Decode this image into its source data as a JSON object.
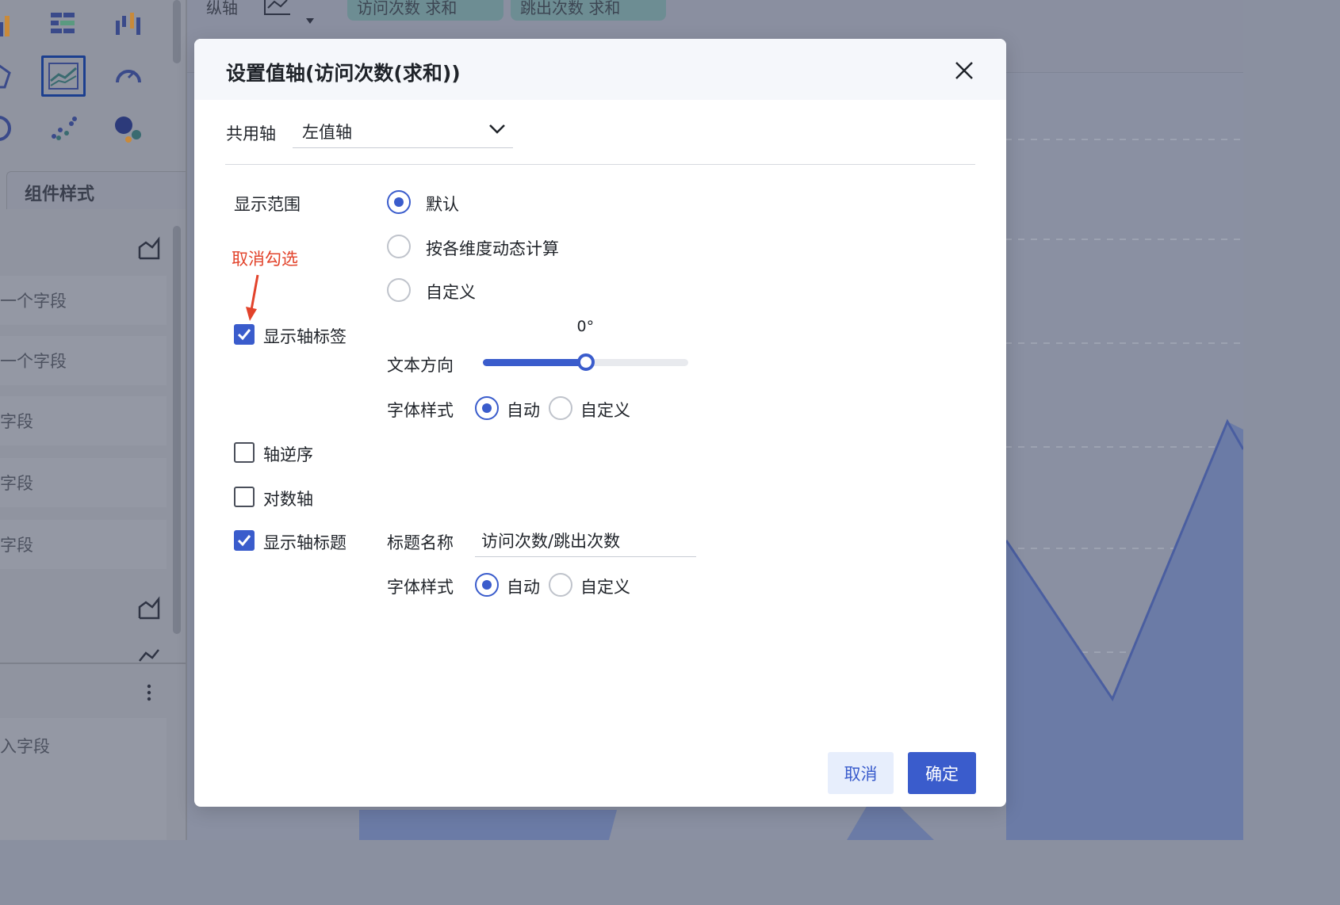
{
  "background": {
    "sidebar": {
      "style_tab_label": "组件样式",
      "field_slots": [
        "一个字段",
        "一个字段",
        "字段",
        "字段",
        "字段"
      ],
      "bottom_field_slot": "入字段"
    },
    "topbar": {
      "axis_label": "纵轴",
      "pills": [
        "访问次数 求和",
        "跳出次数 求和"
      ]
    }
  },
  "dialog": {
    "title": "设置值轴(访问次数(求和))",
    "shared_axis": {
      "label": "共用轴",
      "value": "左值轴"
    },
    "display_range": {
      "label": "显示范围",
      "options": [
        "默认",
        "按各维度动态计算",
        "自定义"
      ],
      "selected": "默认"
    },
    "annotation": "取消勾选",
    "show_axis_labels": {
      "label": "显示轴标签",
      "checked": true,
      "text_direction": {
        "label": "文本方向",
        "value": "0°",
        "fill": 0.5
      },
      "font_style": {
        "label": "字体样式",
        "options": [
          "自动",
          "自定义"
        ],
        "selected": "自动"
      }
    },
    "reverse_axis": {
      "label": "轴逆序",
      "checked": false
    },
    "log_axis": {
      "label": "对数轴",
      "checked": false
    },
    "show_axis_title": {
      "label": "显示轴标题",
      "checked": true,
      "title_name": {
        "label": "标题名称",
        "value": "访问次数/跳出次数"
      },
      "font_style": {
        "label": "字体样式",
        "options": [
          "自动",
          "自定义"
        ],
        "selected": "自动"
      }
    },
    "buttons": {
      "cancel": "取消",
      "ok": "确定"
    }
  },
  "colors": {
    "accent": "#3a5ccc",
    "annotation": "#e2432b",
    "overlay_bg": "#8a90a2",
    "chart_fill": "#6b7ba6"
  }
}
